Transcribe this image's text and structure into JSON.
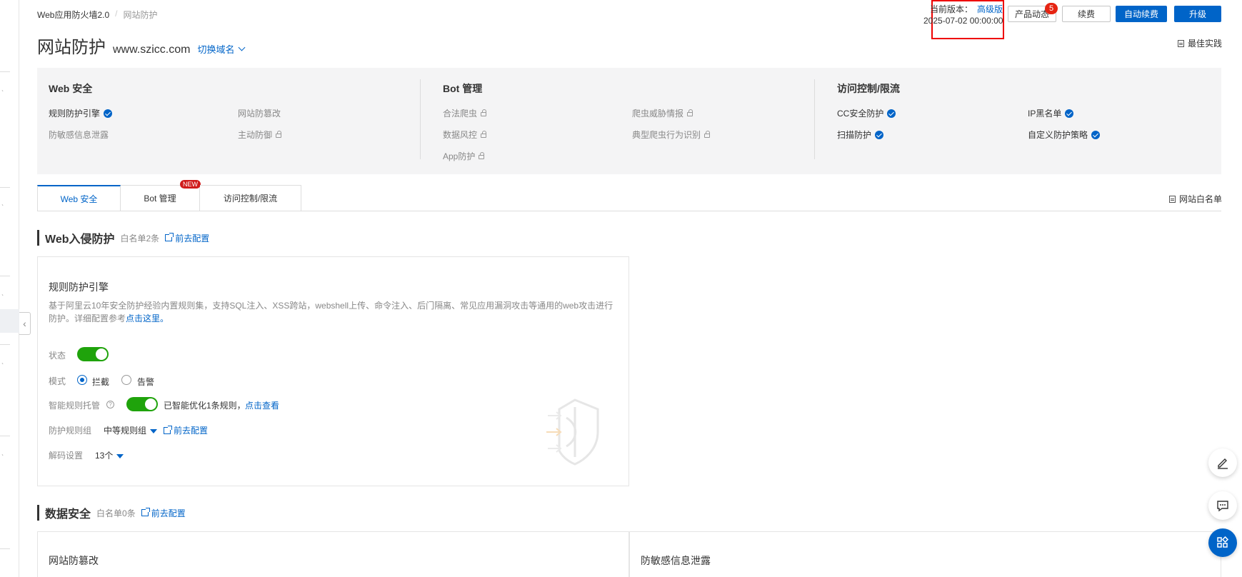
{
  "breadcrumb": {
    "root": "Web应用防火墙2.0",
    "current": "网站防护",
    "separator": "/"
  },
  "header": {
    "title": "网站防护",
    "domain": "www.szicc.com",
    "switch_label": "切换域名",
    "version_label": "当前版本：",
    "version_value": "高级版",
    "expire_time": "2025-07-02 00:00:00",
    "news_label": "产品动态",
    "news_count": "5",
    "renew_label": "续费",
    "auto_renew_label": "自动续费",
    "upgrade_label": "升级",
    "best_practice": "最佳实践"
  },
  "overview": {
    "columns": [
      {
        "title": "Web 安全",
        "items": [
          {
            "label": "规则防护引擎",
            "state": "enabled"
          },
          {
            "label": "网站防篡改",
            "state": "none"
          },
          {
            "label": "防敏感信息泄露",
            "state": "none"
          },
          {
            "label": "主动防御",
            "state": "locked"
          }
        ]
      },
      {
        "title": "Bot 管理",
        "items": [
          {
            "label": "合法爬虫",
            "state": "locked"
          },
          {
            "label": "爬虫威胁情报",
            "state": "locked"
          },
          {
            "label": "数据风控",
            "state": "locked"
          },
          {
            "label": "典型爬虫行为识别",
            "state": "locked"
          },
          {
            "label": "App防护",
            "state": "locked"
          }
        ]
      },
      {
        "title": "访问控制/限流",
        "items": [
          {
            "label": "CC安全防护",
            "state": "enabled"
          },
          {
            "label": "IP黑名单",
            "state": "enabled"
          },
          {
            "label": "扫描防护",
            "state": "enabled"
          },
          {
            "label": "自定义防护策略",
            "state": "enabled"
          }
        ]
      }
    ]
  },
  "tabs": [
    {
      "label": "Web 安全",
      "active": true
    },
    {
      "label": "Bot 管理",
      "badge": "NEW"
    },
    {
      "label": "访问控制/限流"
    }
  ],
  "site_whitelist": "网站白名单",
  "web_intrusion": {
    "title": "Web入侵防护",
    "whitelist_count": "白名单2条",
    "config_link": "前去配置",
    "card": {
      "title": "规则防护引擎",
      "desc": "基于阿里云10年安全防护经验内置规则集，支持SQL注入、XSS跨站，webshell上传、命令注入、后门隔离、常见应用漏洞攻击等通用的web攻击进行防护。详细配置参考",
      "desc_link": "点击这里。",
      "status_label": "状态",
      "status_on": true,
      "mode_label": "模式",
      "mode_block": "拦截",
      "mode_alert": "告警",
      "smart_label": "智能规则托管",
      "smart_on": true,
      "smart_text": "已智能优化1条规则，",
      "smart_link": "点击查看",
      "group_label": "防护规则组",
      "group_value": "中等规则组",
      "group_link": "前去配置",
      "decode_label": "解码设置",
      "decode_value": "13个"
    }
  },
  "data_security": {
    "title": "数据安全",
    "whitelist_count": "白名单0条",
    "config_link": "前去配置",
    "card_left_title": "网站防篡改",
    "card_right_title": "防敏感信息泄露"
  },
  "colors": {
    "accent": "#0064c8",
    "toggle_on": "#1fa30b",
    "badge": "#e62412",
    "highlight_box": "#ee0000"
  }
}
